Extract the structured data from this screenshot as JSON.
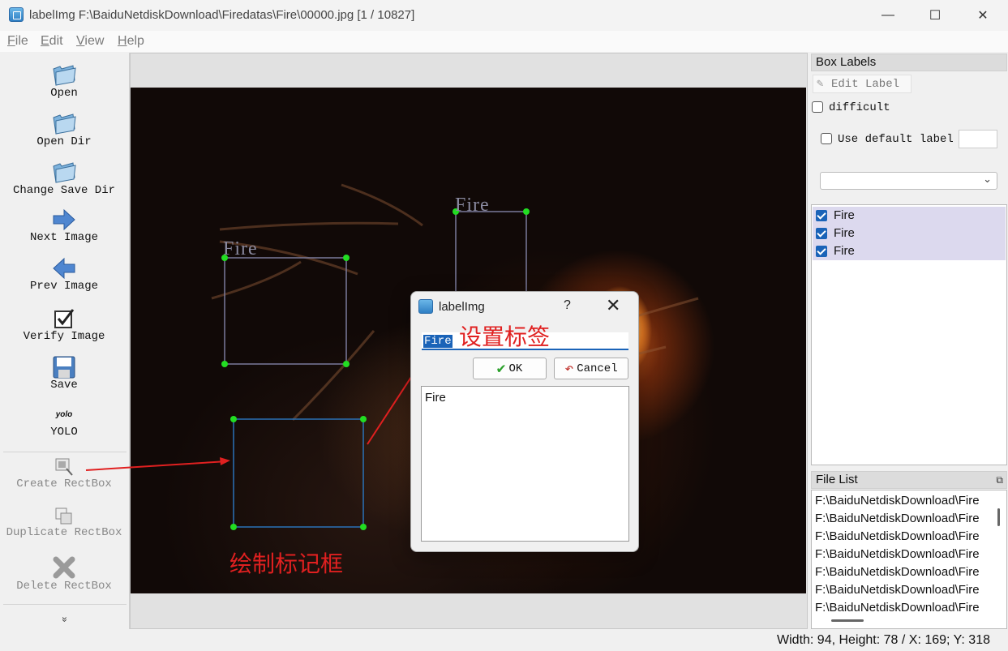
{
  "window": {
    "title": "labelImg F:\\BaiduNetdiskDownload\\Firedatas\\Fire\\00000.jpg [1 / 10827]",
    "minimize": "—",
    "maximize": "☐",
    "close": "✕"
  },
  "menu": [
    "File",
    "Edit",
    "View",
    "Help"
  ],
  "toolbar": {
    "open": "Open",
    "open_dir": "Open Dir",
    "change_save_dir": "Change Save Dir",
    "next_image": "Next Image",
    "prev_image": "Prev Image",
    "verify_image": "Verify Image",
    "save": "Save",
    "format_icon_text": "yolo",
    "format": "YOLO",
    "create_rectbox": "Create RectBox",
    "duplicate_rectbox": "Duplicate RectBox",
    "delete_rectbox": "Delete RectBox",
    "more": "»"
  },
  "canvas": {
    "box_labels": [
      "Fire",
      "Fire"
    ],
    "annotation_draw": "绘制标记框",
    "annotation_set": "设置标签"
  },
  "dialog": {
    "title": "labelImg",
    "help": "?",
    "close": "✕",
    "input_value": "Fire",
    "ok": "OK",
    "cancel": "Cancel",
    "list": [
      "Fire"
    ]
  },
  "box_labels_panel": {
    "title": "Box Labels",
    "edit_label": "Edit Label",
    "difficult": "difficult",
    "use_default_label": "Use default label",
    "default_label_value": "",
    "combo_value": "",
    "labels": [
      "Fire",
      "Fire",
      "Fire"
    ]
  },
  "file_list_panel": {
    "title": "File List",
    "files": [
      "F:\\BaiduNetdiskDownload\\Fire",
      "F:\\BaiduNetdiskDownload\\Fire",
      "F:\\BaiduNetdiskDownload\\Fire",
      "F:\\BaiduNetdiskDownload\\Fire",
      "F:\\BaiduNetdiskDownload\\Fire",
      "F:\\BaiduNetdiskDownload\\Fire",
      "F:\\BaiduNetdiskDownload\\Fire"
    ]
  },
  "status": "Width: 94, Height: 78 / X: 169; Y: 318"
}
